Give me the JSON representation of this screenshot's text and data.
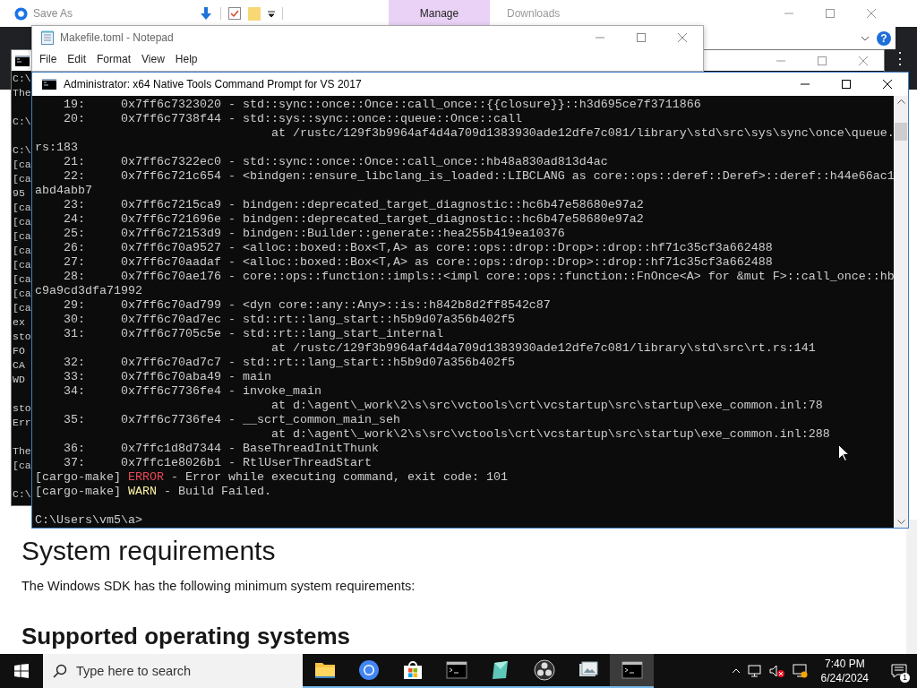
{
  "save_dialog": {
    "title": "Save As"
  },
  "explorer": {
    "context_tab": {
      "label": "Manage",
      "selected": true
    },
    "title": "Downloads",
    "help_glyph": "?"
  },
  "browser": {
    "menu_glyph": "⋮"
  },
  "notepad": {
    "title": "Makefile.toml - Notepad",
    "menu": [
      "File",
      "Edit",
      "Format",
      "View",
      "Help"
    ]
  },
  "background_console": {
    "lines": [
      {
        "kind": "text",
        "text": "C:\\"
      },
      {
        "kind": "text",
        "text": "The"
      },
      {
        "kind": "blank"
      },
      {
        "kind": "text",
        "text": "C:\\"
      },
      {
        "kind": "blank"
      },
      {
        "kind": "text",
        "text": "C:\\"
      },
      {
        "kind": "text",
        "text": "[ca"
      },
      {
        "kind": "text",
        "text": "[ca"
      },
      {
        "kind": "text",
        "text": "95"
      },
      {
        "kind": "text",
        "text": "[ca"
      },
      {
        "kind": "text",
        "text": "[ca"
      },
      {
        "kind": "text",
        "text": "[ca"
      },
      {
        "kind": "text",
        "text": "[ca"
      },
      {
        "kind": "text",
        "text": "[ca"
      },
      {
        "kind": "text",
        "text": "[ca"
      },
      {
        "kind": "text",
        "text": "[ca"
      },
      {
        "kind": "text",
        "text": "[ca"
      },
      {
        "kind": "text",
        "text": "ex"
      },
      {
        "kind": "text",
        "text": "sto"
      },
      {
        "kind": "text",
        "text": "FO"
      },
      {
        "kind": "text",
        "text": "CA"
      },
      {
        "kind": "text",
        "text": "WD"
      },
      {
        "kind": "blank"
      },
      {
        "kind": "text",
        "text": "sto"
      },
      {
        "kind": "text",
        "text": "Err"
      },
      {
        "kind": "blank"
      },
      {
        "kind": "text",
        "text": "The"
      },
      {
        "kind": "text",
        "text": "[ca"
      },
      {
        "kind": "blank"
      },
      {
        "kind": "text",
        "text": "C:\\"
      }
    ]
  },
  "console": {
    "title": "Administrator: x64 Native Tools Command Prompt for VS 2017",
    "lines": [
      {
        "kind": "text",
        "text": "    19:     0x7ff6c7323020 - std::sync::once::Once::call_once::{{closure}}::h3d695ce7f3711866"
      },
      {
        "kind": "text",
        "text": "    20:     0x7ff6c7738f44 - std::sys::sync::once::queue::Once::call"
      },
      {
        "kind": "text",
        "text": "                                 at /rustc/129f3b9964af4d4a709d1383930ade12dfe7c081/library\\std\\src\\sys\\sync\\once\\queue."
      },
      {
        "kind": "text",
        "text": "rs:183"
      },
      {
        "kind": "text",
        "text": "    21:     0x7ff6c7322ec0 - std::sync::once::Once::call_once::hb48a830ad813d4ac"
      },
      {
        "kind": "text",
        "text": "    22:     0x7ff6c721c654 - <bindgen::ensure_libclang_is_loaded::LIBCLANG as core::ops::deref::Deref>::deref::h44e66ac1"
      },
      {
        "kind": "text",
        "text": "abd4abb7"
      },
      {
        "kind": "text",
        "text": "    23:     0x7ff6c7215ca9 - bindgen::deprecated_target_diagnostic::hc6b47e58680e97a2"
      },
      {
        "kind": "text",
        "text": "    24:     0x7ff6c721696e - bindgen::deprecated_target_diagnostic::hc6b47e58680e97a2"
      },
      {
        "kind": "text",
        "text": "    25:     0x7ff6c72153d9 - bindgen::Builder::generate::hea255b419ea10376"
      },
      {
        "kind": "text",
        "text": "    26:     0x7ff6c70a9527 - <alloc::boxed::Box<T,A> as core::ops::drop::Drop>::drop::hf71c35cf3a662488"
      },
      {
        "kind": "text",
        "text": "    27:     0x7ff6c70aadaf - <alloc::boxed::Box<T,A> as core::ops::drop::Drop>::drop::hf71c35cf3a662488"
      },
      {
        "kind": "text",
        "text": "    28:     0x7ff6c70ae176 - core::ops::function::impls::<impl core::ops::function::FnOnce<A> for &mut F>::call_once::hb"
      },
      {
        "kind": "text",
        "text": "c9a9cd3dfa71992"
      },
      {
        "kind": "text",
        "text": "    29:     0x7ff6c70ad799 - <dyn core::any::Any>::is::h842b8d2ff8542c87"
      },
      {
        "kind": "text",
        "text": "    30:     0x7ff6c70ad7ec - std::rt::lang_start::h5b9d07a356b402f5"
      },
      {
        "kind": "text",
        "text": "    31:     0x7ff6c7705c5e - std::rt::lang_start_internal"
      },
      {
        "kind": "text",
        "text": "                                 at /rustc/129f3b9964af4d4a709d1383930ade12dfe7c081/library\\std\\src\\rt.rs:141"
      },
      {
        "kind": "text",
        "text": "    32:     0x7ff6c70ad7c7 - std::rt::lang_start::h5b9d07a356b402f5"
      },
      {
        "kind": "text",
        "text": "    33:     0x7ff6c70aba49 - main"
      },
      {
        "kind": "text",
        "text": "    34:     0x7ff6c7736fe4 - invoke_main"
      },
      {
        "kind": "text",
        "text": "                                 at d:\\agent\\_work\\2\\s\\src\\vctools\\crt\\vcstartup\\src\\startup\\exe_common.inl:78"
      },
      {
        "kind": "text",
        "text": "    35:     0x7ff6c7736fe4 - __scrt_common_main_seh"
      },
      {
        "kind": "text",
        "text": "                                 at d:\\agent\\_work\\2\\s\\src\\vctools\\crt\\vcstartup\\src\\startup\\exe_common.inl:288"
      },
      {
        "kind": "text",
        "text": "    36:     0x7ffc1d8d7344 - BaseThreadInitThunk"
      },
      {
        "kind": "text",
        "text": "    37:     0x7ffc1e8026b1 - RtlUserThreadStart"
      },
      {
        "kind": "colored",
        "segments": [
          {
            "text": "[cargo-make] ",
            "color": "#cccccc"
          },
          {
            "text": "ERROR",
            "color": "#e74856"
          },
          {
            "text": " - Error while executing command, exit code: 101",
            "color": "#cccccc"
          }
        ]
      },
      {
        "kind": "colored",
        "segments": [
          {
            "text": "[cargo-make] ",
            "color": "#cccccc"
          },
          {
            "text": "WARN",
            "color": "#f9f1a5"
          },
          {
            "text": " - Build Failed.",
            "color": "#cccccc"
          }
        ]
      },
      {
        "kind": "blank"
      },
      {
        "kind": "text",
        "text": "C:\\Users\\vm5\\a>"
      }
    ]
  },
  "web_page": {
    "heading": "System requirements",
    "paragraph": "The Windows SDK has the following minimum system requirements:",
    "subheading": "Supported operating systems"
  },
  "taskbar": {
    "search_placeholder": "Type here to search",
    "apps": [
      {
        "kind": "folder",
        "active": false
      },
      {
        "kind": "browser",
        "active": false
      },
      {
        "kind": "store",
        "active": false
      },
      {
        "kind": "terminal",
        "active": false
      },
      {
        "kind": "viewer",
        "active": false
      },
      {
        "kind": "recorder",
        "active": false
      },
      {
        "kind": "gallery",
        "active": false
      },
      {
        "kind": "terminal",
        "active": true
      }
    ],
    "time": "7:40 PM",
    "date": "6/24/2024",
    "notification_count": "1"
  }
}
